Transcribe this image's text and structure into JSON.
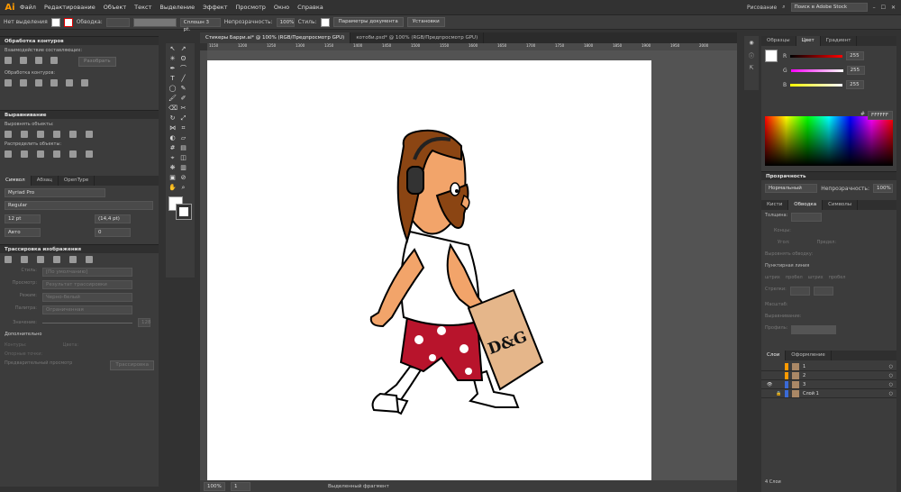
{
  "app": {
    "logo": "Ai"
  },
  "menu": [
    "Файл",
    "Редактирование",
    "Объект",
    "Текст",
    "Выделение",
    "Эффект",
    "Просмотр",
    "Окно",
    "Справка"
  ],
  "topright": {
    "workspace": "Рисование",
    "search_placeholder": "Поиск в Adobe Stock"
  },
  "control": {
    "no_selection": "Нет выделения",
    "stroke": "Обводка:",
    "stroke_style": "Сплошн 3 pt.",
    "opacity_label": "Непрозрачность:",
    "opacity": "100%",
    "style_label": "Стиль:",
    "doc_settings": "Параметры документа",
    "preferences": "Установки"
  },
  "tabs": [
    {
      "label": "Стикеры Барри.ai* @ 100% (RGB/Предпросмотр GPU)"
    },
    {
      "label": "котоби.psd* @ 100% (RGB/Предпросмотр GPU)"
    }
  ],
  "ruler": [
    "1150",
    "1200",
    "1250",
    "1300",
    "1350",
    "1400",
    "1450",
    "1500",
    "1550",
    "1600",
    "1650",
    "1700",
    "1750",
    "1800",
    "1850",
    "1900",
    "1950",
    "2000"
  ],
  "pathfinder": {
    "title": "Обработка контуров",
    "shape_modes": "Взаимодействие составляющих:",
    "expand": "Разобрать",
    "pathfinders": "Обработка контуров:"
  },
  "align": {
    "title": "Выравнивание",
    "align_objects": "Выровнять объекты:",
    "distribute": "Распределить объекты:"
  },
  "character": {
    "tabs": [
      "Символ",
      "Абзац",
      "OpenType"
    ],
    "font": "Myriad Pro",
    "style": "Regular",
    "size": "12 pt",
    "leading": "(14,4 pt)",
    "kerning": "Авто",
    "tracking": "0"
  },
  "trace": {
    "title": "Трассировка изображения",
    "preset": "Стиль:",
    "preset_val": "[По умолчанию]",
    "view": "Просмотр:",
    "view_val": "Результат трассировки",
    "mode": "Режим:",
    "mode_val": "Черно-белый",
    "palette": "Палитра:",
    "palette_val": "Ограниченная",
    "threshold": "Значение:",
    "threshold_val": "128",
    "advanced": "Дополнительно",
    "paths": "Контуры:",
    "anchors": "Опорные точки:",
    "colors": "Цвета:",
    "preview": "Предварительный просмотр",
    "trace_btn": "Трассировка"
  },
  "color": {
    "tabs": [
      "Образцы",
      "Цвет",
      "Градиент"
    ],
    "r_label": "R",
    "g_label": "G",
    "b_label": "B",
    "r": "255",
    "g": "255",
    "b": "255",
    "hex_label": "#",
    "hex": "FFFFFF"
  },
  "transparency": {
    "title": "Прозрачность",
    "mode": "Нормальный",
    "opacity_label": "Непрозрачность:",
    "opacity": "100%"
  },
  "stroke": {
    "tabs": [
      "Кисти",
      "Обводка",
      "Символы"
    ],
    "weight": "Толщина:",
    "caps": "Концы:",
    "corner": "Угол:",
    "limit": "Предел:",
    "align": "Выровнять обводку:",
    "dashed": "Пунктирная линия",
    "dash": "штрих",
    "gap": "пробел",
    "arrows": "Стрелки:",
    "scale": "Масштаб:",
    "align_arrows": "Выравнивание:",
    "profile": "Профиль:"
  },
  "layers": {
    "tabs": [
      "Слои",
      "Оформление"
    ],
    "items": [
      "1",
      "2",
      "3",
      "Слой 1"
    ],
    "count": "4 Слои"
  },
  "status": {
    "zoom": "100%",
    "page": "1",
    "tool": "Выделенный фрагмент"
  },
  "colors": {
    "accent": "#ff9a00",
    "bg": "#323232"
  }
}
